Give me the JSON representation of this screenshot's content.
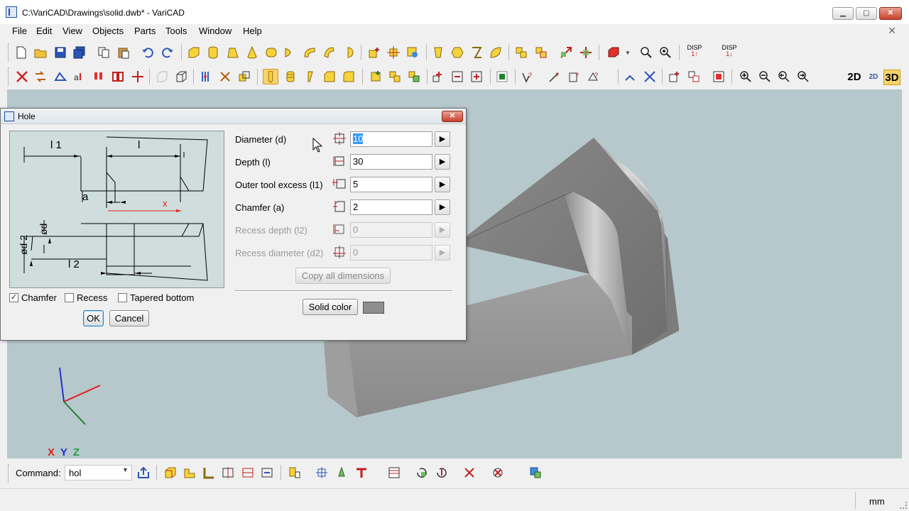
{
  "window": {
    "title": "C:\\VariCAD\\Drawings\\solid.dwb* - VariCAD",
    "minimize_icon": "minimize-icon",
    "maximize_icon": "maximize-icon",
    "close_icon": "close-icon"
  },
  "menu": {
    "items": [
      {
        "label": "File"
      },
      {
        "label": "Edit"
      },
      {
        "label": "View"
      },
      {
        "label": "Objects"
      },
      {
        "label": "Parts"
      },
      {
        "label": "Tools"
      },
      {
        "label": "Window"
      },
      {
        "label": "Help"
      }
    ],
    "close_glyph": "✕"
  },
  "view_modes": {
    "mode_2d": "2D",
    "mode_2d3d": "2D",
    "mode_3d": "3D",
    "active": "3D"
  },
  "dialog": {
    "title": "Hole",
    "close_glyph": "✕",
    "fields": [
      {
        "label": "Diameter (d)",
        "value": "10",
        "enabled": true,
        "selected": true,
        "icon": "diameter-icon"
      },
      {
        "label": "Depth (l)",
        "value": "30",
        "enabled": true,
        "selected": false,
        "icon": "depth-icon"
      },
      {
        "label": "Outer tool excess (l1)",
        "value": "5",
        "enabled": true,
        "selected": false,
        "icon": "tool-excess-icon"
      },
      {
        "label": "Chamfer (a)",
        "value": "2",
        "enabled": true,
        "selected": false,
        "icon": "chamfer-icon"
      },
      {
        "label": "Recess depth (l2)",
        "value": "0",
        "enabled": false,
        "selected": false,
        "icon": "recess-depth-icon"
      },
      {
        "label": "Recess diameter (d2)",
        "value": "0",
        "enabled": false,
        "selected": false,
        "icon": "recess-diameter-icon"
      }
    ],
    "arrow_glyph": "▶",
    "copy_all_label": "Copy all dimensions",
    "solid_color_label": "Solid color",
    "solid_color_value": "#8e8e8e",
    "checkboxes": {
      "chamfer": {
        "label": "Chamfer",
        "checked": true
      },
      "recess": {
        "label": "Recess",
        "checked": false
      },
      "tapered": {
        "label": "Tapered bottom",
        "checked": false
      }
    },
    "check_glyph": "✓",
    "ok_label": "OK",
    "cancel_label": "Cancel",
    "preview": {
      "l1": "l 1",
      "l": "l",
      "a": "a",
      "x": "x",
      "d": "ød",
      "d2": "ød 2",
      "l2": "l 2"
    }
  },
  "axes": {
    "x": "X",
    "y": "Y",
    "z": "Z",
    "colors": {
      "x": "#e02020",
      "y": "#2030d0",
      "z": "#20a040"
    }
  },
  "command_bar": {
    "label": "Command:",
    "value": "hol",
    "dropdown_glyph": "▼"
  },
  "status_bar": {
    "units": "mm"
  },
  "toolbar_disp": {
    "disp_label_1": "DISP",
    "disp_label_2": "DISP"
  }
}
